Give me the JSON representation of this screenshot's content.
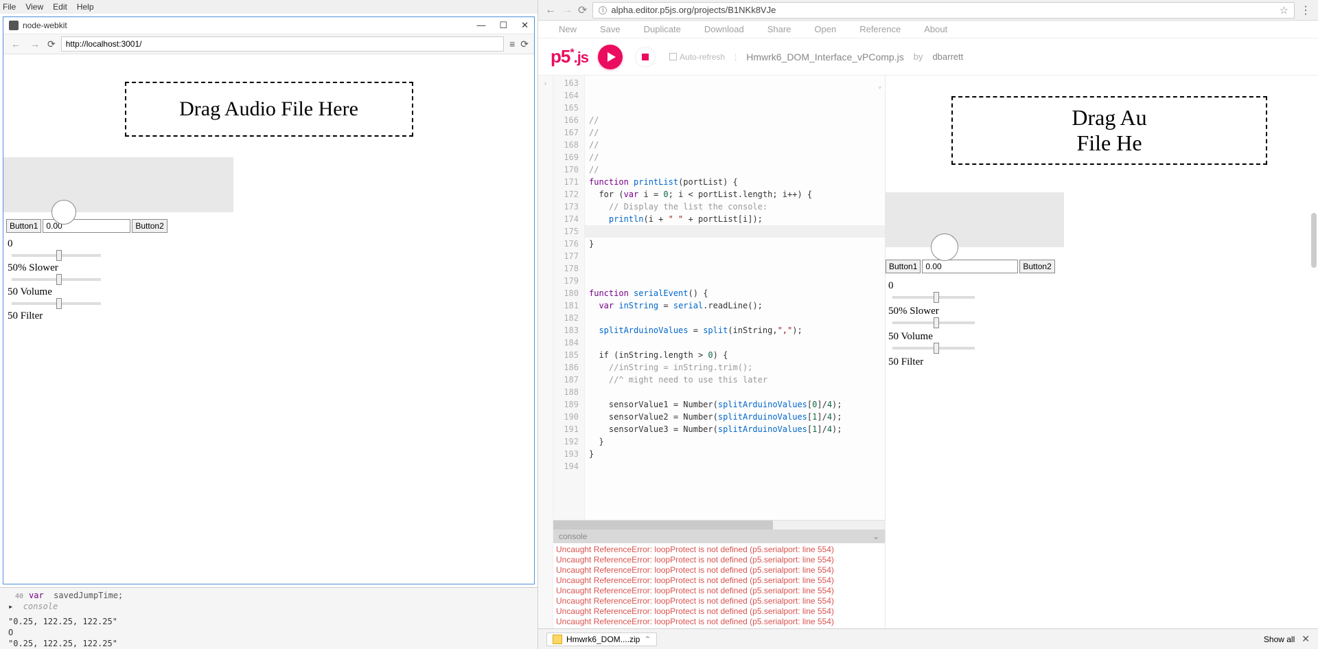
{
  "os_menu": [
    "File",
    "View",
    "Edit",
    "Help"
  ],
  "nw": {
    "title": "node-webkit",
    "address": "http://localhost:3001/",
    "drop_text": "Drag Audio File Here",
    "button1": "Button1",
    "button2": "Button2",
    "num_value": "0.00",
    "labels": {
      "zero": "0",
      "slower": "50% Slower",
      "volume": "50 Volume",
      "filter": "50 Filter"
    }
  },
  "left_console": {
    "line0": "var  savedJumpTime;",
    "num0": "40",
    "expand": "▸",
    "faded": "console",
    "line1": "\"0.25, 122.25, 122.25\"",
    "line2": "O",
    "line3": "\"0.25, 122.25, 122.25\""
  },
  "chrome": {
    "address": "alpha.editor.p5js.org/projects/B1NKk8VJe"
  },
  "p5tb": [
    "New",
    "Save",
    "Duplicate",
    "Download",
    "Share",
    "Open",
    "Reference",
    "About"
  ],
  "p5": {
    "logo": "p5",
    "logo_suffix": ".js",
    "autorefresh": "Auto-refresh",
    "filename": "Hmwrk6_DOM_Interface_vPComp.js",
    "by": "by",
    "author": "dbarrett"
  },
  "line_nos": [
    "163",
    "164",
    "165",
    "166",
    "167",
    "168",
    "169",
    "170",
    "171",
    "172",
    "173",
    "174",
    "175",
    "176",
    "177",
    "178",
    "179",
    "180",
    "181",
    "182",
    "183",
    "184",
    "185",
    "186",
    "187",
    "188",
    "189",
    "190",
    "191",
    "192",
    "193",
    "194"
  ],
  "code": {
    "l163": "//",
    "l164": "//",
    "l165": "//",
    "l166": "//",
    "l167": "//",
    "l168a": "function ",
    "l168b": "printList",
    "l168c": "(portList) {",
    "l169a": "  for (",
    "l169b": "var",
    "l169c": " i = ",
    "l169d": "0",
    "l169e": "; i < portList.length; i++) {",
    "l170": "    // Display the list the console:",
    "l171a": "    println",
    "l171b": "(i + ",
    "l171c": "\" \"",
    "l171d": " + portList[i]);",
    "l172": "  }",
    "l173": "}",
    "l174": "",
    "l175": "",
    "l176": "",
    "l177a": "function ",
    "l177b": "serialEvent",
    "l177c": "() {",
    "l178a": "  var ",
    "l178b": "inString",
    "l178c": " = ",
    "l178d": "serial",
    "l178e": ".readLine();",
    "l179": "",
    "l180a": "  splitArduinoValues",
    "l180b": " = ",
    "l180c": "split",
    "l180d": "(inString,",
    "l180e": "\",\"",
    "l180f": ");",
    "l181": "",
    "l182a": "  if (inString.length > ",
    "l182b": "0",
    "l182c": ") {",
    "l183": "    //inString = inString.trim();",
    "l184": "    //^ might need to use this later",
    "l185": "",
    "l186a": "    sensorValue1 = Number(",
    "l186b": "splitArduinoValues",
    "l186c": "[",
    "l186d": "0",
    "l186e": "]/",
    "l186f": "4",
    "l186g": ");",
    "l187a": "    sensorValue2 = Number(",
    "l187b": "splitArduinoValues",
    "l187c": "[",
    "l187d": "1",
    "l187e": "]/",
    "l187f": "4",
    "l187g": ");",
    "l188a": "    sensorValue3 = Number(",
    "l188b": "splitArduinoValues",
    "l188c": "[",
    "l188d": "1",
    "l188e": "]/",
    "l188f": "4",
    "l188g": ");",
    "l189": "  }",
    "l190": "}",
    "l191": "",
    "l192": "",
    "l193": "",
    "l194": ""
  },
  "console": {
    "title": "console",
    "err": "Uncaught ReferenceError: loopProtect is not defined (p5.serialport: line 554)"
  },
  "preview": {
    "drop_text": "Drag Audio File Here",
    "button1": "Button1",
    "button2": "Button2",
    "num_value": "0.00",
    "labels": {
      "zero": "0",
      "slower": "50% Slower",
      "volume": "50 Volume",
      "filter": "50 Filter"
    }
  },
  "dl": {
    "filename": "Hmwrk6_DOM....zip",
    "showall": "Show all"
  }
}
